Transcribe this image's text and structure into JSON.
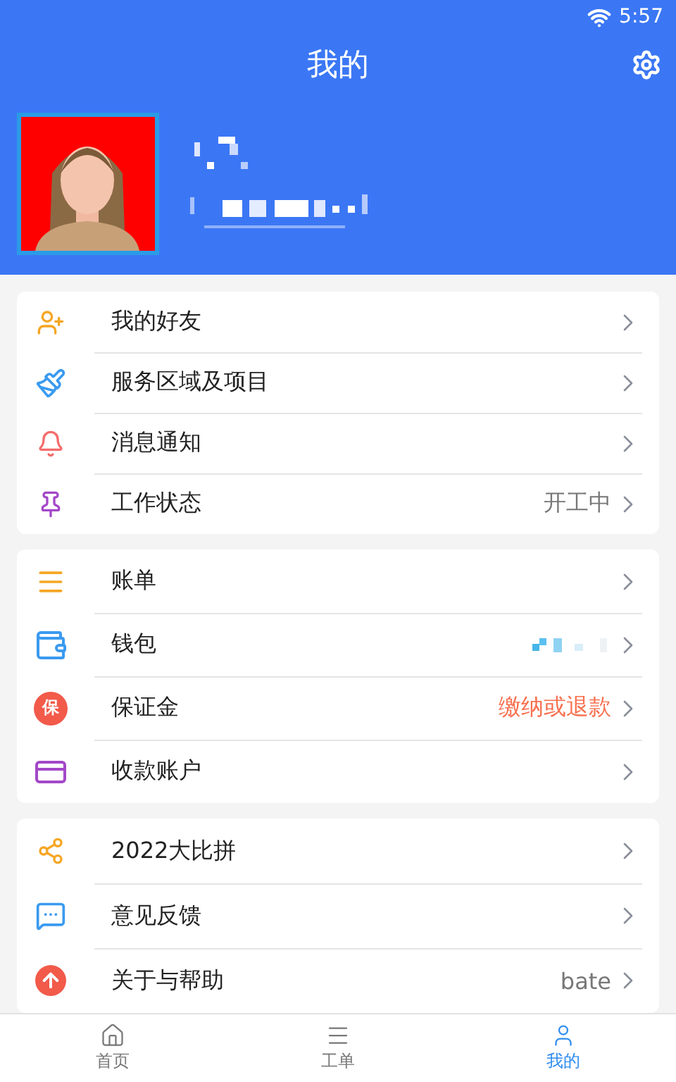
{
  "status_bar": {
    "time": "5:57"
  },
  "header": {
    "title": "我的"
  },
  "profile": {
    "name_blurred": true
  },
  "groups": [
    {
      "items": [
        {
          "label": "我的好友"
        },
        {
          "label": "服务区域及项目"
        },
        {
          "label": "消息通知"
        },
        {
          "label": "工作状态",
          "value": "开工中",
          "highlight": false
        }
      ]
    },
    {
      "items": [
        {
          "label": "账单"
        },
        {
          "label": "钱包",
          "blurred_value": true
        },
        {
          "label": "保证金",
          "value": "缴纳或退款",
          "highlight": true,
          "badge": "保"
        },
        {
          "label": "收款账户"
        }
      ]
    },
    {
      "items": [
        {
          "label": "2022大比拼"
        },
        {
          "label": "意见反馈"
        },
        {
          "label": "关于与帮助",
          "value": "bate",
          "highlight": false
        }
      ]
    }
  ],
  "tabs": [
    {
      "label": "首页",
      "selected": false
    },
    {
      "label": "工单",
      "selected": false
    },
    {
      "label": "我的",
      "selected": true
    }
  ]
}
